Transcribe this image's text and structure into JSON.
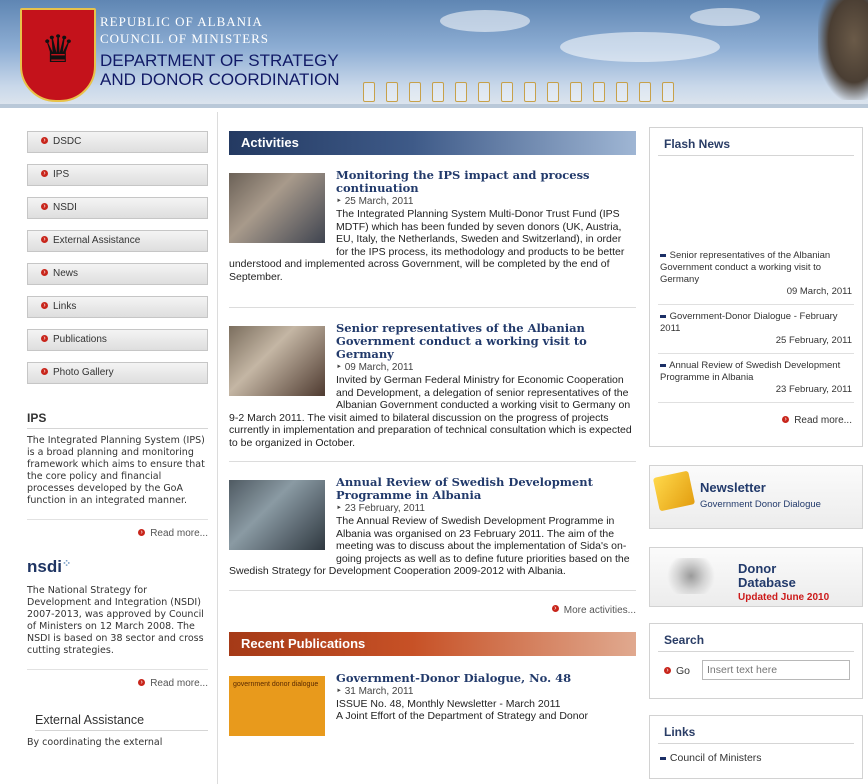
{
  "header": {
    "republic": "REPUBLIC OF ALBANIA",
    "council": "COUNCIL OF MINISTERS",
    "dept_line1": "DEPARTMENT OF STRATEGY",
    "dept_line2": "AND DONOR COORDINATION"
  },
  "nav": [
    "DSDC",
    "IPS",
    "NSDI",
    "External Assistance",
    "News",
    "Links",
    "Publications",
    "Photo Gallery"
  ],
  "ips": {
    "title": "IPS",
    "text": "The Integrated Planning System (IPS) is a broad planning and monitoring framework which aims to ensure that the core policy and financial processes developed by the GoA function in an integrated manner.",
    "read_more": "Read more..."
  },
  "nsdi": {
    "logo": "nsdi",
    "text": "The National Strategy for Development and Integration (NSDI) 2007-2013, was approved by Council of Ministers on 12 March 2008. The NSDI is based on 38 sector and cross cutting strategies.",
    "read_more": "Read more..."
  },
  "external": {
    "title": "External Assistance",
    "text": "By coordinating the external"
  },
  "activities": {
    "title": "Activities",
    "items": [
      {
        "title": "Monitoring the IPS impact and process continuation",
        "date": "25 March, 2011",
        "body": "The Integrated Planning System Multi-Donor Trust Fund (IPS MDTF) which has been funded by seven donors (UK, Austria, EU, Italy, the Netherlands, Sweden and Switzerland), in order for the IPS process, its methodology and products to be better understood and implemented across Government, will be completed by the end of September."
      },
      {
        "title": "Senior representatives of the Albanian Government conduct a working visit to Germany",
        "date": "09 March, 2011",
        "body": "Invited by German Federal Ministry for Economic Cooperation and Development, a delegation of senior representatives of the Albanian Government conducted a working visit to Germany on 9-2 March 2011. The visit aimed to bilateral discussion on the progress of projects currently in implementation and preparation of technical consultation which is expected to be organized in October."
      },
      {
        "title": "Annual Review of Swedish Development Programme in Albania",
        "date": "23 February, 2011",
        "body": "The Annual Review of Swedish Development Programme in Albania was organised on 23 February 2011. The aim of the meeting was to discuss about the implementation of Sida's on-going projects as well as to define future priorities based on the Swedish Strategy for Development Cooperation 2009-2012 with Albania."
      }
    ],
    "more": "More activities..."
  },
  "publications": {
    "title": "Recent Publications",
    "item": {
      "title": "Government-Donor Dialogue, No. 48",
      "date": "31 March, 2011",
      "line1": "ISSUE No. 48, Monthly Newsletter - March 2011",
      "line2": "A Joint Effort of the Department of Strategy and Donor",
      "thumb_text": "government donor dialogue"
    }
  },
  "flash": {
    "title": "Flash News",
    "items": [
      {
        "text": "Senior representatives of the Albanian Government conduct a working visit to Germany",
        "date": "09 March, 2011"
      },
      {
        "text": "Government-Donor Dialogue - February 2011",
        "date": "25 February, 2011"
      },
      {
        "text": "Annual Review of Swedish Development Programme in Albania",
        "date": "23 February, 2011"
      }
    ],
    "read_more": "Read more..."
  },
  "newsletter": {
    "title": "Newsletter",
    "subtitle": "Government Donor Dialogue"
  },
  "donor": {
    "line1": "Donor",
    "line2": "Database",
    "updated": "Updated June 2010"
  },
  "search": {
    "title": "Search",
    "go": "Go",
    "placeholder": "Insert text here"
  },
  "links": {
    "title": "Links",
    "items": [
      "Council of Ministers"
    ]
  },
  "colors": {
    "accent_red": "#c8251b",
    "navy": "#223a6b",
    "donor_red": "#cc1a1a"
  }
}
